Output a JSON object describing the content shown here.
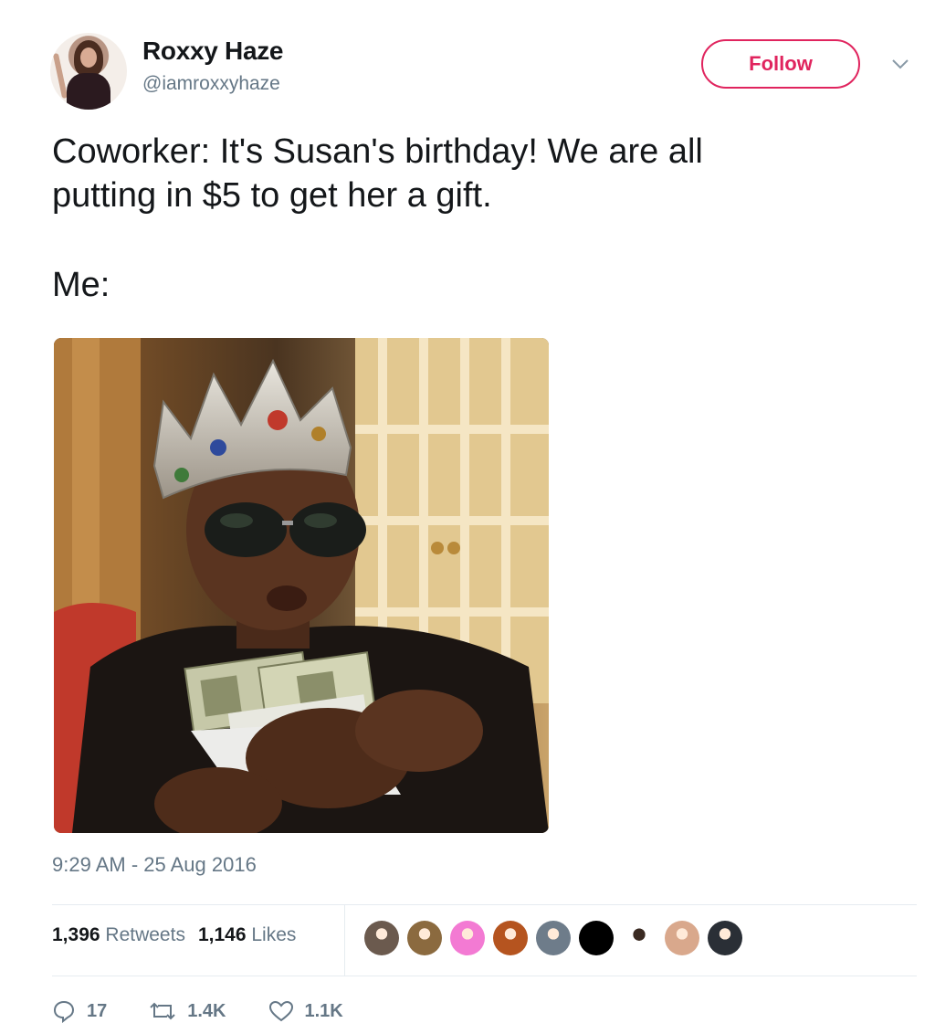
{
  "tweet": {
    "display_name": "Roxxy Haze",
    "handle": "@iamroxxyhaze",
    "follow_label": "Follow",
    "text_lines": [
      "Coworker: It's Susan's birthday! We are all",
      "putting in $5 to get her a gift."
    ],
    "text_second": "Me:",
    "timestamp": "9:29 AM - 25 Aug 2016"
  },
  "stats": {
    "retweets_count": "1,396",
    "retweets_label": "Retweets",
    "likes_count": "1,146",
    "likes_label": "Likes"
  },
  "likers": [
    {
      "name": "liker-avatar-1",
      "color": "#6b5a4e"
    },
    {
      "name": "liker-avatar-2",
      "color": "#8b6a3f"
    },
    {
      "name": "liker-avatar-3",
      "color": "#f37ad3"
    },
    {
      "name": "liker-avatar-4",
      "color": "#b5541f"
    },
    {
      "name": "liker-avatar-5",
      "color": "#6e7c8a"
    },
    {
      "name": "liker-avatar-6",
      "color": "#000000"
    },
    {
      "name": "liker-avatar-7",
      "color": "#ffffff"
    },
    {
      "name": "liker-avatar-8",
      "color": "#d9a88c"
    },
    {
      "name": "liker-avatar-9",
      "color": "#2a2f36"
    }
  ],
  "actions": {
    "reply_count": "17",
    "retweet_count": "1.4K",
    "like_count": "1.1K"
  },
  "icons": {
    "reply": "reply-icon",
    "retweet": "retweet-icon",
    "like": "heart-icon",
    "more": "chevron-down-icon"
  },
  "colors": {
    "follow_accent": "#e0245e",
    "secondary_text": "#657786",
    "primary_text": "#14171a"
  }
}
